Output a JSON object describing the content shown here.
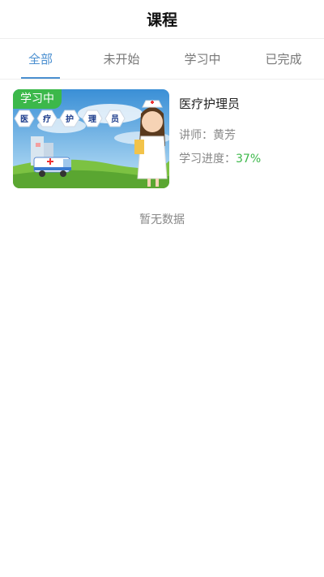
{
  "header": {
    "title": "课程"
  },
  "tabs": [
    {
      "label": "全部"
    },
    {
      "label": "未开始"
    },
    {
      "label": "学习中"
    },
    {
      "label": "已完成"
    }
  ],
  "active_tab_index": 0,
  "course": {
    "status": "学习中",
    "thumb_chars": [
      "医",
      "疗",
      "护",
      "理",
      "员"
    ],
    "name": "医疗护理员",
    "lecturer_label": "讲师：",
    "lecturer": "黄芳",
    "progress_label": "学习进度：",
    "progress_value": "37%"
  },
  "empty_text": "暂无数据",
  "colors": {
    "accent": "#4a8fd0",
    "success": "#3cb84a"
  }
}
